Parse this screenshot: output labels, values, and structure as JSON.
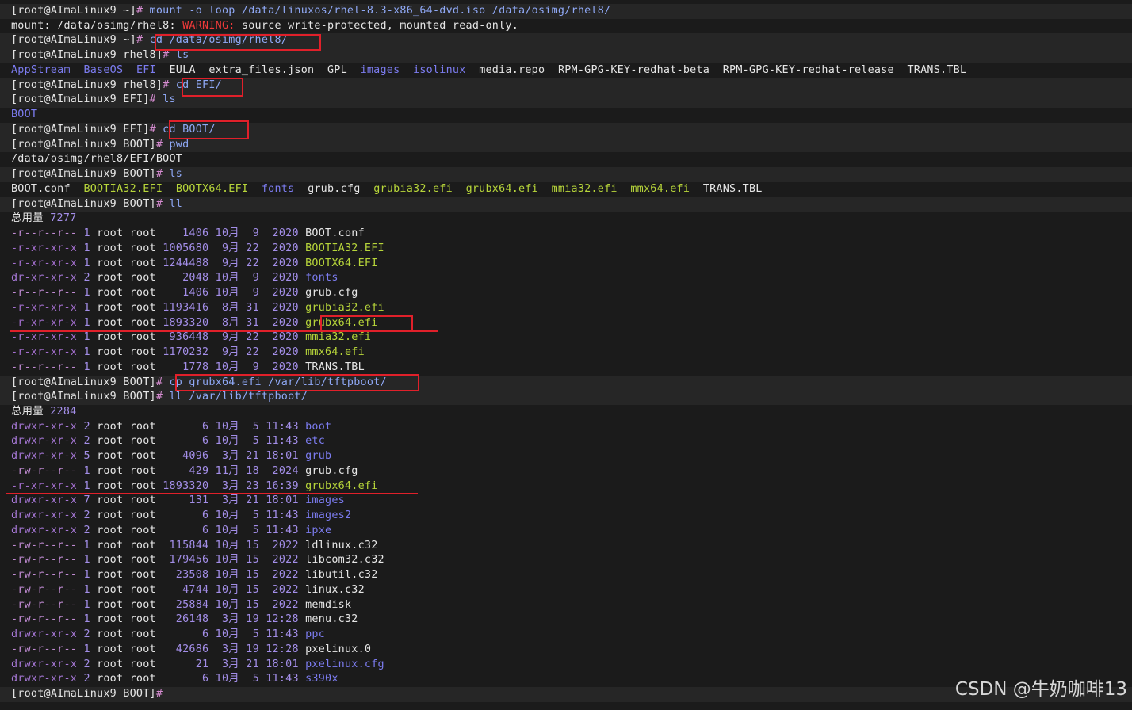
{
  "terminal": {
    "lines": [
      {
        "t": "prompt",
        "p": "[root@AImaLinux9 ~]",
        "h": "#",
        "c": " mount -o loop /data/linuxos/rhel-8.3-x86_64-dvd.iso /data/osimg/rhel8/"
      },
      {
        "t": "warn",
        "a": "mount: /data/osimg/rhel8: ",
        "w": "WARNING:",
        "b": " source write-protected, mounted read-only."
      },
      {
        "t": "prompt",
        "p": "[root@AImaLinux9 ~]",
        "h": "#",
        "c": " cd /data/osimg/rhel8/"
      },
      {
        "t": "prompt",
        "p": "[root@AImaLinux9 rhel8]",
        "h": "#",
        "c": " ls"
      },
      {
        "t": "ls",
        "items": [
          [
            "AppStream",
            "dir"
          ],
          [
            "BaseOS",
            "dir"
          ],
          [
            "EFI",
            "dir"
          ],
          [
            "EULA",
            "plain"
          ],
          [
            "extra_files.json",
            "plain"
          ],
          [
            "GPL",
            "plain"
          ],
          [
            "images",
            "dir"
          ],
          [
            "isolinux",
            "dir"
          ],
          [
            "media.repo",
            "plain"
          ],
          [
            "RPM-GPG-KEY-redhat-beta",
            "plain"
          ],
          [
            "RPM-GPG-KEY-redhat-release",
            "plain"
          ],
          [
            "TRANS.TBL",
            "plain"
          ]
        ]
      },
      {
        "t": "prompt",
        "p": "[root@AImaLinux9 rhel8]",
        "h": "#",
        "c": " cd EFI/"
      },
      {
        "t": "prompt",
        "p": "[root@AImaLinux9 EFI]",
        "h": "#",
        "c": " ls"
      },
      {
        "t": "ls",
        "items": [
          [
            "BOOT",
            "dir"
          ]
        ]
      },
      {
        "t": "prompt",
        "p": "[root@AImaLinux9 EFI]",
        "h": "#",
        "c": " cd BOOT/"
      },
      {
        "t": "prompt",
        "p": "[root@AImaLinux9 BOOT]",
        "h": "#",
        "c": " pwd"
      },
      {
        "t": "text",
        "v": "/data/osimg/rhel8/EFI/BOOT"
      },
      {
        "t": "prompt",
        "p": "[root@AImaLinux9 BOOT]",
        "h": "#",
        "c": " ls"
      },
      {
        "t": "ls",
        "items": [
          [
            "BOOT.conf",
            "plain"
          ],
          [
            "BOOTIA32.EFI",
            "exe"
          ],
          [
            "BOOTX64.EFI",
            "exe"
          ],
          [
            "fonts",
            "dir"
          ],
          [
            "grub.cfg",
            "plain"
          ],
          [
            "grubia32.efi",
            "exe"
          ],
          [
            "grubx64.efi",
            "exe"
          ],
          [
            "mmia32.efi",
            "exe"
          ],
          [
            "mmx64.efi",
            "exe"
          ],
          [
            "TRANS.TBL",
            "plain"
          ]
        ]
      },
      {
        "t": "prompt",
        "p": "[root@AImaLinux9 BOOT]",
        "h": "#",
        "c": " ll"
      },
      {
        "t": "total",
        "label": "总用量 ",
        "n": "7277"
      },
      {
        "t": "ll",
        "perm": "-r--r--r--",
        "k": "file",
        "n": "1",
        "o": "root root",
        "sz": "   1406",
        "d": " 10月  9  2020",
        "name": "BOOT.conf",
        "nk": "plain"
      },
      {
        "t": "ll",
        "perm": "-r-xr-xr-x",
        "k": "exe",
        "n": "1",
        "o": "root root",
        "sz": "1005680",
        "d": "  9月 22  2020",
        "name": "BOOTIA32.EFI",
        "nk": "exe"
      },
      {
        "t": "ll",
        "perm": "-r-xr-xr-x",
        "k": "exe",
        "n": "1",
        "o": "root root",
        "sz": "1244488",
        "d": "  9月 22  2020",
        "name": "BOOTX64.EFI",
        "nk": "exe"
      },
      {
        "t": "ll",
        "perm": "dr-xr-xr-x",
        "k": "dir",
        "n": "2",
        "o": "root root",
        "sz": "   2048",
        "d": " 10月  9  2020",
        "name": "fonts",
        "nk": "dir"
      },
      {
        "t": "ll",
        "perm": "-r--r--r--",
        "k": "file",
        "n": "1",
        "o": "root root",
        "sz": "   1406",
        "d": " 10月  9  2020",
        "name": "grub.cfg",
        "nk": "plain"
      },
      {
        "t": "ll",
        "perm": "-r-xr-xr-x",
        "k": "exe",
        "n": "1",
        "o": "root root",
        "sz": "1193416",
        "d": "  8月 31  2020",
        "name": "grubia32.efi",
        "nk": "exe"
      },
      {
        "t": "ll",
        "perm": "-r-xr-xr-x",
        "k": "exe",
        "n": "1",
        "o": "root root",
        "sz": "1893320",
        "d": "  8月 31  2020",
        "name": "grubx64.efi",
        "nk": "exe"
      },
      {
        "t": "ll",
        "perm": "-r-xr-xr-x",
        "k": "exe",
        "n": "1",
        "o": "root root",
        "sz": " 936448",
        "d": "  9月 22  2020",
        "name": "mmia32.efi",
        "nk": "exe"
      },
      {
        "t": "ll",
        "perm": "-r-xr-xr-x",
        "k": "exe",
        "n": "1",
        "o": "root root",
        "sz": "1170232",
        "d": "  9月 22  2020",
        "name": "mmx64.efi",
        "nk": "exe"
      },
      {
        "t": "ll",
        "perm": "-r--r--r--",
        "k": "file",
        "n": "1",
        "o": "root root",
        "sz": "   1778",
        "d": " 10月  9  2020",
        "name": "TRANS.TBL",
        "nk": "plain"
      },
      {
        "t": "prompt",
        "p": "[root@AImaLinux9 BOOT]",
        "h": "#",
        "c": " cp grubx64.efi /var/lib/tftpboot/"
      },
      {
        "t": "prompt",
        "p": "[root@AImaLinux9 BOOT]",
        "h": "#",
        "c": " ll /var/lib/tftpboot/"
      },
      {
        "t": "total",
        "label": "总用量 ",
        "n": "2284"
      },
      {
        "t": "ll",
        "perm": "drwxr-xr-x",
        "k": "dir",
        "n": "2",
        "o": "root root",
        "sz": "      6",
        "d": " 10月  5 11:43",
        "name": "boot",
        "nk": "dir"
      },
      {
        "t": "ll",
        "perm": "drwxr-xr-x",
        "k": "dir",
        "n": "2",
        "o": "root root",
        "sz": "      6",
        "d": " 10月  5 11:43",
        "name": "etc",
        "nk": "dir"
      },
      {
        "t": "ll",
        "perm": "drwxr-xr-x",
        "k": "dir",
        "n": "5",
        "o": "root root",
        "sz": "   4096",
        "d": "  3月 21 18:01",
        "name": "grub",
        "nk": "dir"
      },
      {
        "t": "ll",
        "perm": "-rw-r--r--",
        "k": "file",
        "n": "1",
        "o": "root root",
        "sz": "    429",
        "d": " 11月 18  2024",
        "name": "grub.cfg",
        "nk": "plain"
      },
      {
        "t": "ll",
        "perm": "-r-xr-xr-x",
        "k": "exe",
        "n": "1",
        "o": "root root",
        "sz": "1893320",
        "d": "  3月 23 16:39",
        "name": "grubx64.efi",
        "nk": "exe"
      },
      {
        "t": "ll",
        "perm": "drwxr-xr-x",
        "k": "dir",
        "n": "7",
        "o": "root root",
        "sz": "    131",
        "d": "  3月 21 18:01",
        "name": "images",
        "nk": "dir"
      },
      {
        "t": "ll",
        "perm": "drwxr-xr-x",
        "k": "dir",
        "n": "2",
        "o": "root root",
        "sz": "      6",
        "d": " 10月  5 11:43",
        "name": "images2",
        "nk": "dir"
      },
      {
        "t": "ll",
        "perm": "drwxr-xr-x",
        "k": "dir",
        "n": "2",
        "o": "root root",
        "sz": "      6",
        "d": " 10月  5 11:43",
        "name": "ipxe",
        "nk": "dir"
      },
      {
        "t": "ll",
        "perm": "-rw-r--r--",
        "k": "file",
        "n": "1",
        "o": "root root",
        "sz": " 115844",
        "d": " 10月 15  2022",
        "name": "ldlinux.c32",
        "nk": "plain"
      },
      {
        "t": "ll",
        "perm": "-rw-r--r--",
        "k": "file",
        "n": "1",
        "o": "root root",
        "sz": " 179456",
        "d": " 10月 15  2022",
        "name": "libcom32.c32",
        "nk": "plain"
      },
      {
        "t": "ll",
        "perm": "-rw-r--r--",
        "k": "file",
        "n": "1",
        "o": "root root",
        "sz": "  23508",
        "d": " 10月 15  2022",
        "name": "libutil.c32",
        "nk": "plain"
      },
      {
        "t": "ll",
        "perm": "-rw-r--r--",
        "k": "file",
        "n": "1",
        "o": "root root",
        "sz": "   4744",
        "d": " 10月 15  2022",
        "name": "linux.c32",
        "nk": "plain"
      },
      {
        "t": "ll",
        "perm": "-rw-r--r--",
        "k": "file",
        "n": "1",
        "o": "root root",
        "sz": "  25884",
        "d": " 10月 15  2022",
        "name": "memdisk",
        "nk": "plain"
      },
      {
        "t": "ll",
        "perm": "-rw-r--r--",
        "k": "file",
        "n": "1",
        "o": "root root",
        "sz": "  26148",
        "d": "  3月 19 12:28",
        "name": "menu.c32",
        "nk": "plain"
      },
      {
        "t": "ll",
        "perm": "drwxr-xr-x",
        "k": "dir",
        "n": "2",
        "o": "root root",
        "sz": "      6",
        "d": " 10月  5 11:43",
        "name": "ppc",
        "nk": "dir"
      },
      {
        "t": "ll",
        "perm": "-rw-r--r--",
        "k": "file",
        "n": "1",
        "o": "root root",
        "sz": "  42686",
        "d": "  3月 19 12:28",
        "name": "pxelinux.0",
        "nk": "plain"
      },
      {
        "t": "ll",
        "perm": "drwxr-xr-x",
        "k": "dir",
        "n": "2",
        "o": "root root",
        "sz": "     21",
        "d": "  3月 21 18:01",
        "name": "pxelinux.cfg",
        "nk": "dir"
      },
      {
        "t": "ll",
        "perm": "drwxr-xr-x",
        "k": "dir",
        "n": "2",
        "o": "root root",
        "sz": "      6",
        "d": " 10月  5 11:43",
        "name": "s390x",
        "nk": "dir"
      },
      {
        "t": "prompt",
        "p": "[root@AImaLinux9 BOOT]",
        "h": "#",
        "c": ""
      }
    ]
  },
  "watermark": "CSDN @牛奶咖啡13",
  "colors": {
    "background": "#1b1b1b",
    "highlight": "#e0202a",
    "directory": "#7c7cf0",
    "executable": "#b7d53a"
  }
}
